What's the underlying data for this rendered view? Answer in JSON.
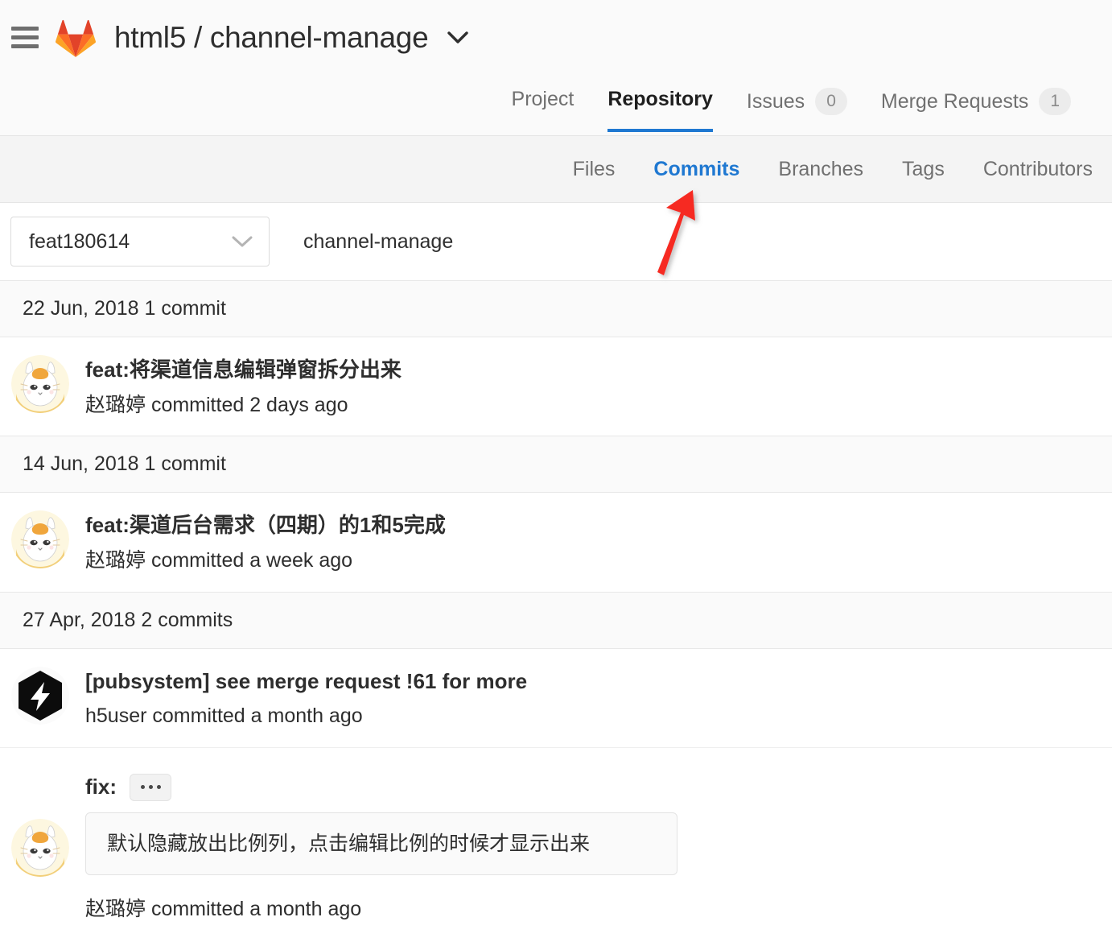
{
  "header": {
    "menu_icon": "hamburger-menu-icon",
    "logo_icon": "gitlab-logo-icon",
    "project_path": "html5 / channel-manage",
    "caret_icon": "chevron-down-icon"
  },
  "primary_nav": [
    {
      "label": "Project",
      "badge": null,
      "active": false
    },
    {
      "label": "Repository",
      "badge": null,
      "active": true
    },
    {
      "label": "Issues",
      "badge": "0",
      "active": false
    },
    {
      "label": "Merge Requests",
      "badge": "1",
      "active": false
    }
  ],
  "sub_nav": [
    {
      "label": "Files",
      "active": false
    },
    {
      "label": "Commits",
      "active": true
    },
    {
      "label": "Branches",
      "active": false
    },
    {
      "label": "Tags",
      "active": false
    },
    {
      "label": "Contributors",
      "active": false
    }
  ],
  "branch_bar": {
    "selected_branch": "feat180614",
    "dropdown_icon": "chevron-down-icon",
    "repo_name": "channel-manage"
  },
  "commit_groups": [
    {
      "date_label": "22 Jun, 2018 1 commit",
      "commits": [
        {
          "avatar": "cat-avatar",
          "title": "feat:将渠道信息编辑弹窗拆分出来",
          "meta": "赵璐婷 committed 2 days ago"
        }
      ]
    },
    {
      "date_label": "14 Jun, 2018 1 commit",
      "commits": [
        {
          "avatar": "cat-avatar",
          "title": "feat:渠道后台需求（四期）的1和5完成",
          "meta": "赵璐婷 committed a week ago"
        }
      ]
    },
    {
      "date_label": "27 Apr, 2018 2 commits",
      "commits": [
        {
          "avatar": "hexagon-bolt-avatar",
          "title": "[pubsystem] see merge request !61 for more",
          "meta": "h5user committed a month ago"
        },
        {
          "avatar": "cat-avatar",
          "title": "fix:",
          "expand_button": "...",
          "description": "默认隐藏放出比例列，点击编辑比例的时候才显示出来",
          "meta": "赵璐婷 committed a month ago"
        }
      ]
    }
  ],
  "annotation": {
    "arrow_color": "#f62b20",
    "points_at": "Commits"
  },
  "colors": {
    "active_tab_blue": "#1f78d1",
    "header_bg": "#fafafa",
    "subnav_bg": "#f4f4f4",
    "border": "#e5e5e5",
    "text": "#2e2e2e",
    "muted_text": "#707070"
  }
}
